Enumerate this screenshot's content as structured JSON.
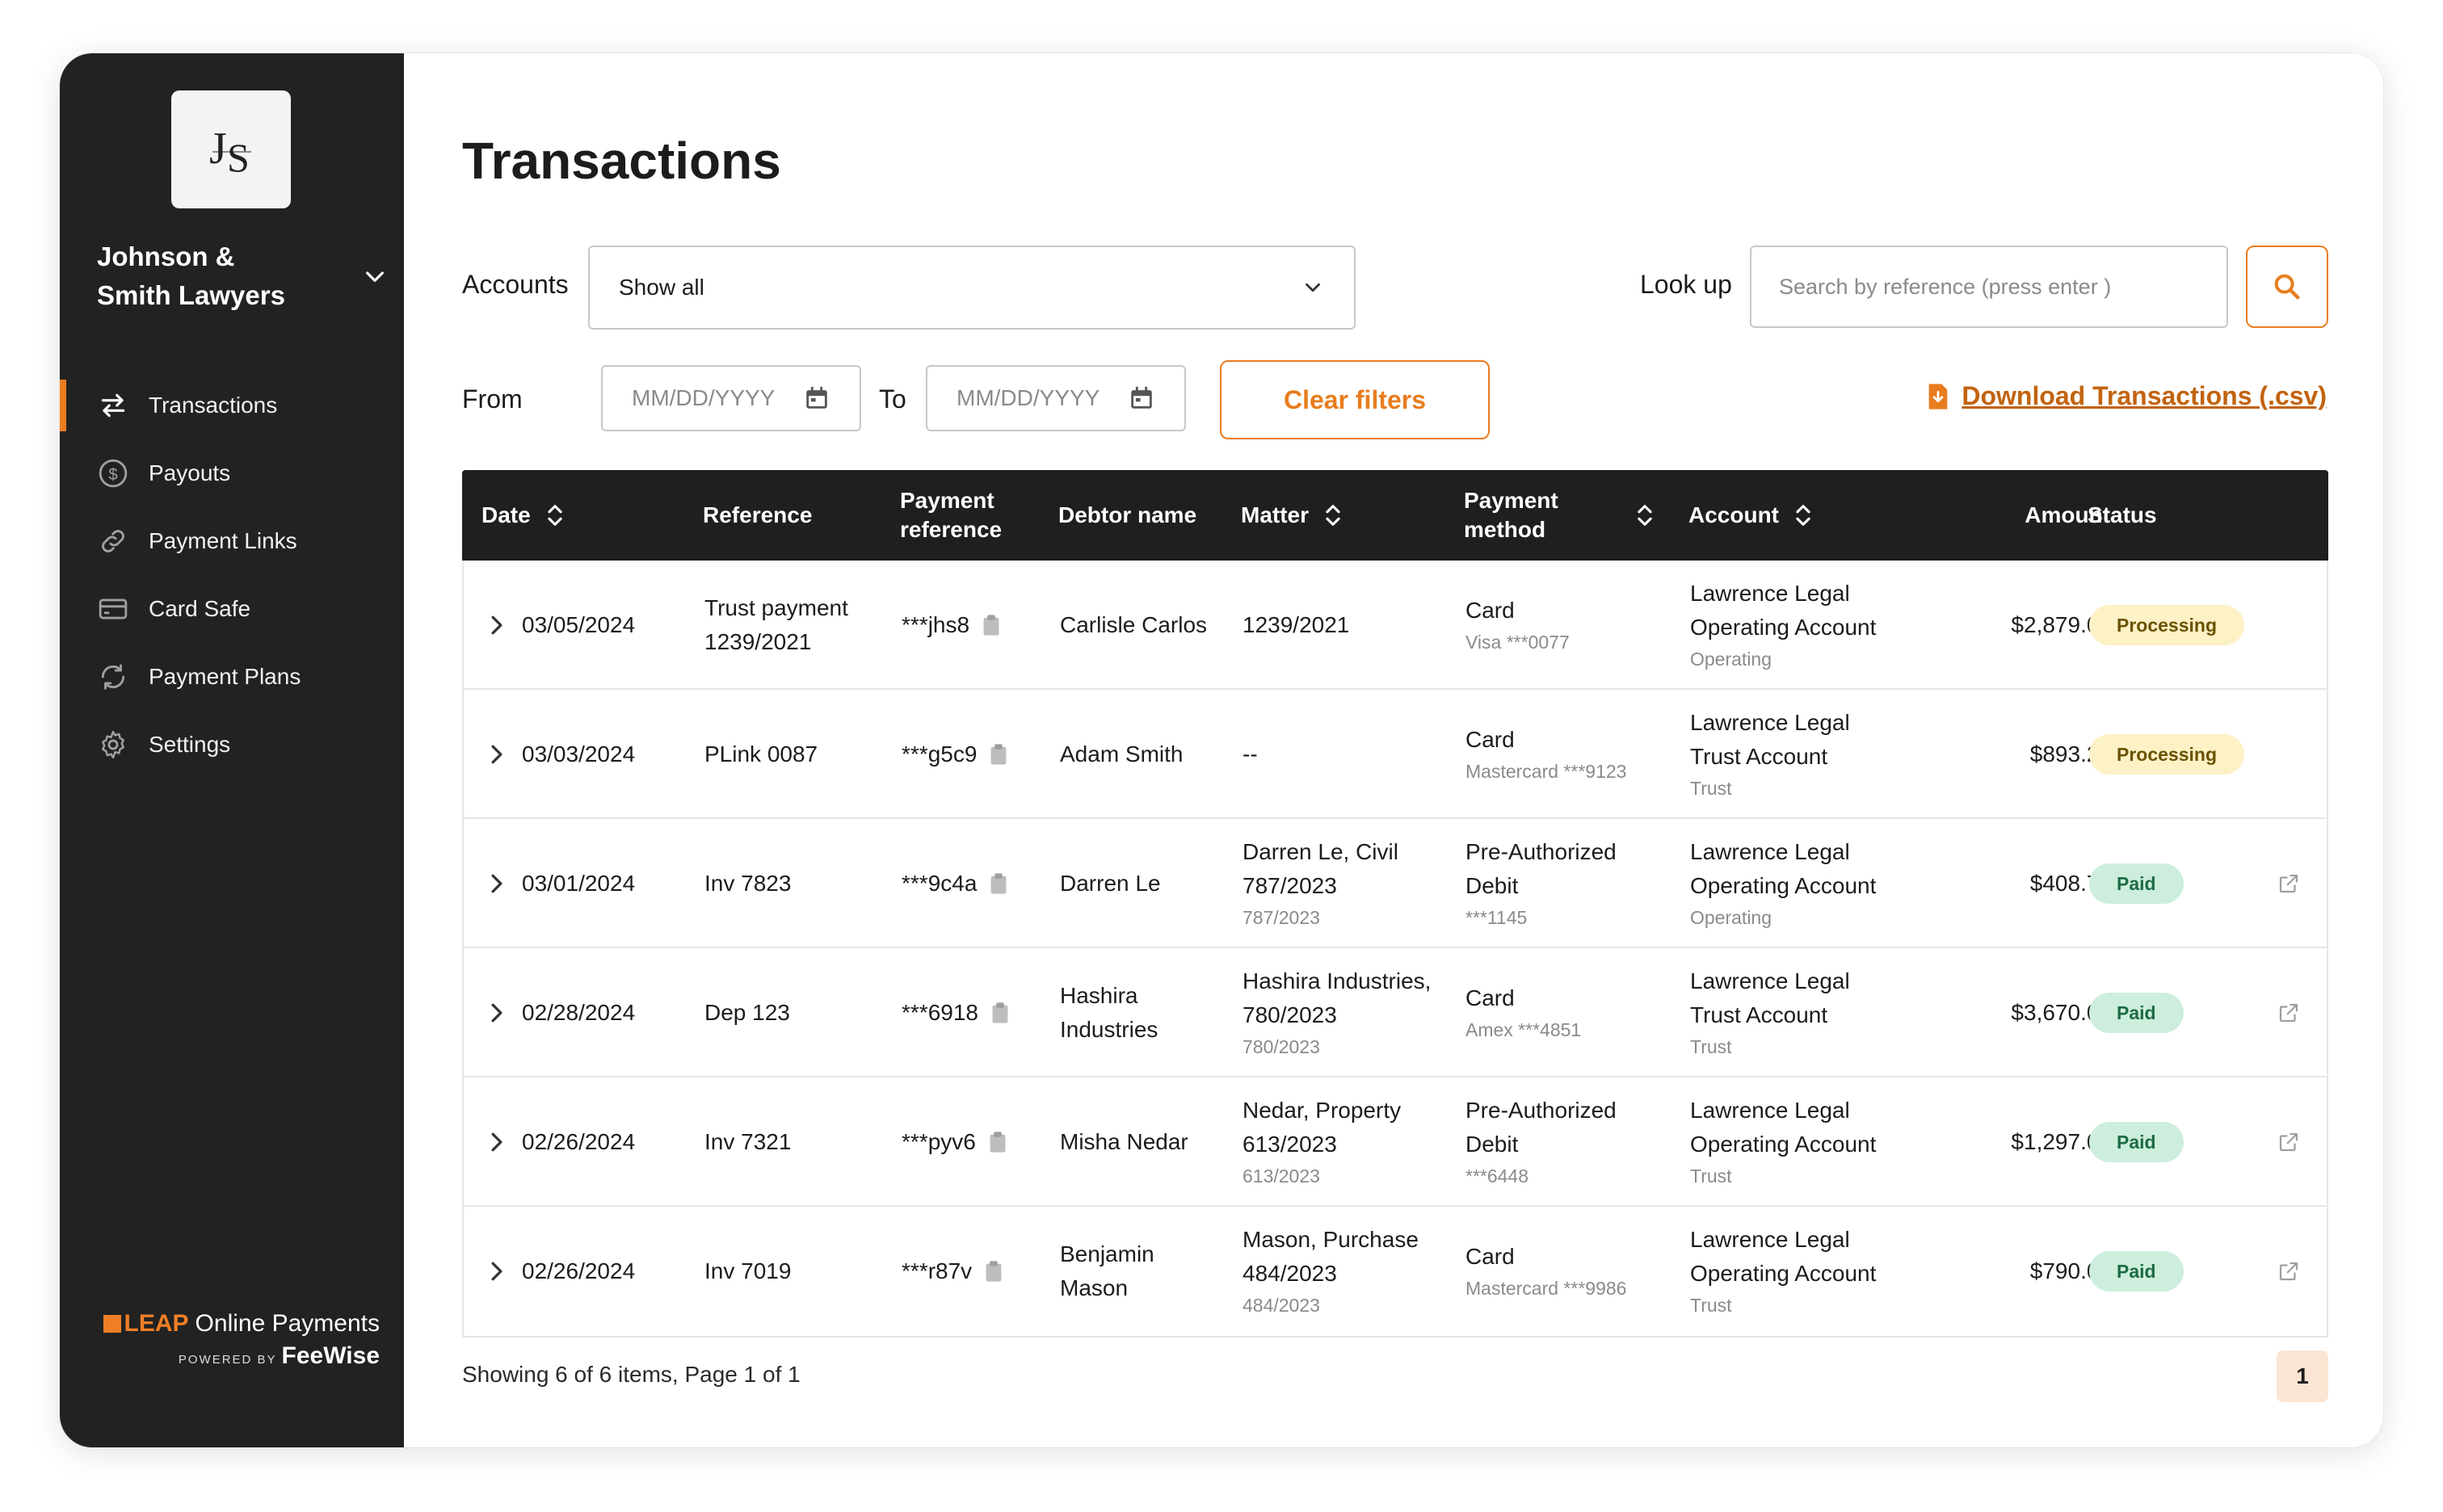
{
  "sidebar": {
    "firm_name": "Johnson & Smith Lawyers",
    "logo_text": "JS",
    "items": [
      {
        "label": "Transactions",
        "icon": "transfer-icon",
        "active": true
      },
      {
        "label": "Payouts",
        "icon": "dollar-circle-icon"
      },
      {
        "label": "Payment Links",
        "icon": "link-icon"
      },
      {
        "label": "Card Safe",
        "icon": "credit-card-icon"
      },
      {
        "label": "Payment Plans",
        "icon": "payment-plan-icon"
      },
      {
        "label": "Settings",
        "icon": "gear-icon"
      }
    ],
    "brand": {
      "leap": "LEAP",
      "product": "Online Payments",
      "powered_by": "POWERED BY",
      "feewise": "FeeWise"
    }
  },
  "page": {
    "title": "Transactions"
  },
  "filters": {
    "accounts_label": "Accounts",
    "accounts_value": "Show all",
    "lookup_label": "Look up",
    "lookup_placeholder": "Search by reference (press enter  )",
    "from_label": "From",
    "to_label": "To",
    "date_placeholder": "MM/DD/YYYY",
    "clear_label": "Clear filters",
    "download_label": "Download Transactions (.csv)"
  },
  "table": {
    "headers": {
      "date": "Date",
      "reference": "Reference",
      "payment_reference": "Payment reference",
      "debtor": "Debtor name",
      "matter": "Matter",
      "payment_method": "Payment method",
      "account": "Account",
      "amount": "Amount",
      "status": "Status"
    },
    "rows": [
      {
        "date": "03/05/2024",
        "ref1": "Trust payment",
        "ref2": "1239/2021",
        "pref": "***jhs8",
        "debtor1": "Carlisle Carlos",
        "debtor2": "",
        "matter1": "1239/2021",
        "matter2": "",
        "matter_sub": "",
        "method1": "Card",
        "method2": "",
        "method_sub": "Visa ***0077",
        "acct1": "Lawrence Legal",
        "acct2": "Operating Account",
        "acct_sub": "Operating",
        "amount": "$2,879.00",
        "status": "Processing"
      },
      {
        "date": "03/03/2024",
        "ref1": "PLink 0087",
        "ref2": "",
        "pref": "***g5c9",
        "debtor1": "Adam Smith",
        "debtor2": "",
        "matter1": "--",
        "matter2": "",
        "matter_sub": "",
        "method1": "Card",
        "method2": "",
        "method_sub": "Mastercard ***9123",
        "acct1": "Lawrence Legal",
        "acct2": "Trust Account",
        "acct_sub": "Trust",
        "amount": "$893.27",
        "status": "Processing"
      },
      {
        "date": "03/01/2024",
        "ref1": "Inv 7823",
        "ref2": "",
        "pref": "***9c4a",
        "debtor1": "Darren Le",
        "debtor2": "",
        "matter1": "Darren Le, Civil",
        "matter2": "787/2023",
        "matter_sub": "787/2023",
        "method1": "Pre-Authorized",
        "method2": "Debit",
        "method_sub": "***1145",
        "acct1": "Lawrence Legal",
        "acct2": "Operating Account",
        "acct_sub": "Operating",
        "amount": "$408.78",
        "status": "Paid"
      },
      {
        "date": "02/28/2024",
        "ref1": "Dep 123",
        "ref2": "",
        "pref": "***6918",
        "debtor1": "Hashira",
        "debtor2": "Industries",
        "matter1": "Hashira Industries,",
        "matter2": "780/2023",
        "matter_sub": "780/2023",
        "method1": "Card",
        "method2": "",
        "method_sub": "Amex ***4851",
        "acct1": "Lawrence Legal",
        "acct2": "Trust Account",
        "acct_sub": "Trust",
        "amount": "$3,670.00",
        "status": "Paid"
      },
      {
        "date": "02/26/2024",
        "ref1": "Inv 7321",
        "ref2": "",
        "pref": "***pyv6",
        "debtor1": "Misha Nedar",
        "debtor2": "",
        "matter1": "Nedar, Property",
        "matter2": "613/2023",
        "matter_sub": "613/2023",
        "method1": "Pre-Authorized",
        "method2": "Debit",
        "method_sub": "***6448",
        "acct1": "Lawrence Legal",
        "acct2": "Operating Account",
        "acct_sub": "Trust",
        "amount": "$1,297.00",
        "status": "Paid"
      },
      {
        "date": "02/26/2024",
        "ref1": "Inv 7019",
        "ref2": "",
        "pref": "***r87v",
        "debtor1": "Benjamin",
        "debtor2": "Mason",
        "matter1": "Mason, Purchase",
        "matter2": "484/2023",
        "matter_sub": "484/2023",
        "method1": "Card",
        "method2": "",
        "method_sub": "Mastercard ***9986",
        "acct1": "Lawrence Legal",
        "acct2": "Operating Account",
        "acct_sub": "Trust",
        "amount": "$790.00",
        "status": "Paid"
      }
    ]
  },
  "pagination": {
    "summary": "Showing 6 of 6 items, Page 1 of 1",
    "current_page": "1"
  },
  "colors": {
    "accent": "#e87d1e",
    "sidebar_bg": "#222222",
    "header_bg": "#1f1f1f",
    "processing_bg": "#fdf1c6",
    "paid_bg": "#cdeedd"
  }
}
